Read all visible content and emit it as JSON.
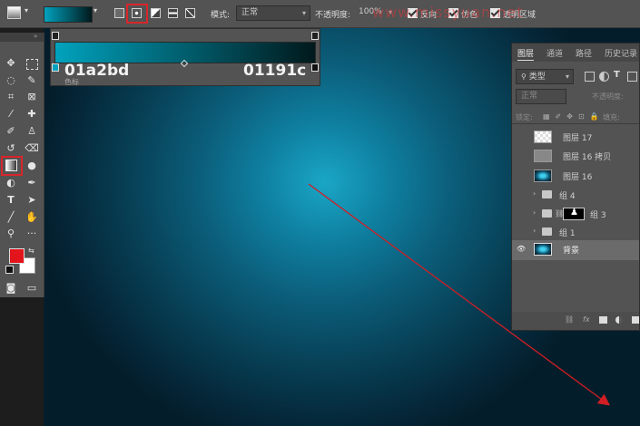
{
  "options_bar": {
    "mode_label": "模式:",
    "mode_value": "正常",
    "opacity_label": "不透明度:",
    "opacity_value": "100%",
    "reverse_label": "反向",
    "dither_label": "仿色",
    "transparency_label": "透明区域",
    "watermark": "www.missyuan.net"
  },
  "gradient_editor": {
    "color_left": "01a2bd",
    "color_right": "01191c",
    "stop_label": "色标"
  },
  "layers_panel": {
    "tabs": [
      "图层",
      "通道",
      "路径",
      "历史记录"
    ],
    "filter_kind": "类型",
    "blend_mode": "正常",
    "opacity_label": "不透明度:",
    "lock_label": "锁定:",
    "fill_label": "填充:",
    "layers": [
      {
        "name": "图层 17"
      },
      {
        "name": "图层 16 拷贝"
      },
      {
        "name": "图层 16"
      },
      {
        "name": "组 4"
      },
      {
        "name": "组 3"
      },
      {
        "name": "组 1"
      },
      {
        "name": "背景"
      }
    ]
  },
  "colors": {
    "gradient_start": "#01a2bd",
    "gradient_end": "#01191c",
    "foreground": "#e3141b",
    "background": "#ffffff",
    "highlight": "#d7262b"
  }
}
